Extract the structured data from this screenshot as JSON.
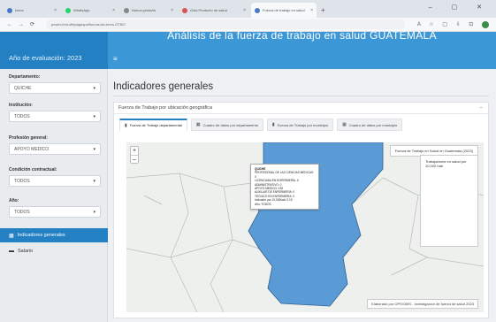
{
  "browser": {
    "tabs": [
      {
        "label": "Inbox",
        "active": false
      },
      {
        "label": "WhatsApp",
        "active": false
      },
      {
        "label": "Nueva pestaña",
        "active": false
      },
      {
        "label": "Guia Producto de salud",
        "active": false
      },
      {
        "label": "Fuerza de trabajo en salud",
        "active": true
      }
    ],
    "new_tab": "+",
    "url": "power-bmi-sfetpagaspa/fuerza-lab-tores-GTBO",
    "window_controls": "– ▢ ✕",
    "nav": {
      "back": "←",
      "forward": "→",
      "reload": "⟳"
    },
    "right_icons": [
      "A",
      "☆",
      "▢",
      "⇩",
      "⊡"
    ]
  },
  "header": {
    "brand": "Año de evaluación: 2023",
    "menu_icon": "≡",
    "title": "Análisis de la fuerza de trabajo en salud GUATEMALA"
  },
  "sidebar": {
    "filters": [
      {
        "label": "Departamento:",
        "value": "QUICHE"
      },
      {
        "label": "Institución:",
        "value": "TODOS"
      },
      {
        "label": "Profesión general:",
        "value": "APOYO MEDICO"
      },
      {
        "label": "Condición contractual:",
        "value": "TODOS"
      },
      {
        "label": "Año:",
        "value": "TODOS"
      }
    ],
    "menu": [
      {
        "label": "Indicadores generales",
        "icon": "chart-icon",
        "active": true
      },
      {
        "label": "Salario",
        "icon": "money-icon",
        "active": false
      }
    ]
  },
  "main": {
    "heading": "Indicadores generales",
    "card": {
      "title": "Fuerza de Trabajo por ubicación geográfica",
      "collapse": "–",
      "tabs": [
        {
          "label": "Fuerza de Trabajo departamental",
          "active": true
        },
        {
          "label": "Cuadro de datos por departamento",
          "active": false
        },
        {
          "label": "Fuerza de Trabajo por municipio",
          "active": false
        },
        {
          "label": "Cuadro de datos por municipio",
          "active": false
        }
      ]
    },
    "map": {
      "zoom_in": "+",
      "zoom_out": "–",
      "title": "Fuerza de Trabajo en Salud en Guatemala (2023)",
      "legend_title": "Trabajadores en salud por 10,000 hab",
      "region_color": "#5b9bd5",
      "tooltip": {
        "title": "QUICHE",
        "lines": [
          "PROFESIONAL DE LAS CIENCIAS MEDICAS: 0",
          "LICENCIADA EN ENFERMERÍA: 0",
          "ADMINISTRATIVO: 0",
          "APOYO MEDICO: 135",
          "AUXILIAR DE ENFERMERÍA: 0",
          "TECNICO EN ENFERMERÍA: 0",
          "Indicador por 10,000hab: 0.15",
          "Año: TODOS"
        ]
      },
      "attribution": "Elaborado por OPS/OMS - Investigación de fuerza de salud 2023"
    }
  }
}
